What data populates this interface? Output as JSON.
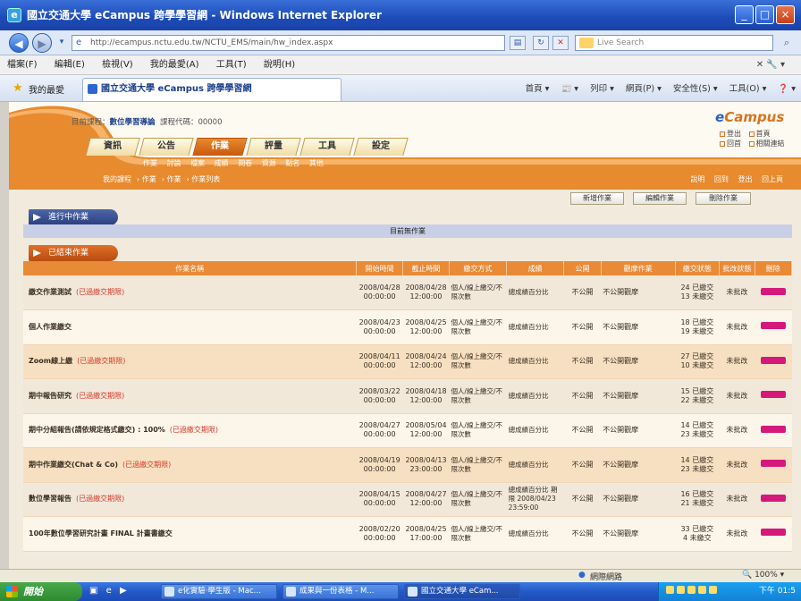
{
  "window": {
    "title": "國立交通大學 eCampus 跨學學習網 - Windows Internet Explorer",
    "min": "_",
    "max": "□",
    "close": "×"
  },
  "address": {
    "url": "http://ecampus.nctu.edu.tw/NCTU_EMS/main/hw_index.aspx",
    "search_placeholder": "Live Search"
  },
  "menu": {
    "items": [
      "檔案(F)",
      "編輯(E)",
      "檢視(V)",
      "我的最愛(A)",
      "工具(T)",
      "說明(H)"
    ],
    "right": "✕ 🔧 ▾"
  },
  "tabs": {
    "favorites": "我的最愛",
    "active_tab": "國立交通大學 eCampus 跨學學習網",
    "commands": [
      "首頁 ▾",
      "📰 ▾",
      "列印 ▾",
      "網頁(P) ▾",
      "安全性(S) ▾",
      "工具(O) ▾",
      "❓ ▾"
    ]
  },
  "page": {
    "user_label": "目前課程：",
    "course": "數位學習導論",
    "role_label": "課程代碼：",
    "code": "00000",
    "logo_prefix": "e",
    "logo": "Campus",
    "header_links": [
      "登出",
      "首頁",
      "回首",
      "相關連結"
    ],
    "nav": [
      "資訊",
      "公告",
      "作業",
      "評量",
      "工具",
      "設定"
    ],
    "submenu": [
      "作業",
      "討論",
      "檔案",
      "成績",
      "問卷",
      "資源",
      "點名",
      "其他"
    ],
    "breadcrumb": [
      "我的課程",
      "作業",
      "作業",
      "作業列表"
    ],
    "right_links": [
      "說明",
      "回到",
      "登出",
      "回上頁"
    ],
    "action_buttons": [
      "新增作業",
      "編輯作業",
      "刪除作業"
    ],
    "section_current": "進行中作業",
    "section_current_empty": "目前無作業",
    "section_past": "已結束作業",
    "columns": [
      "作業名稱",
      "開始時間",
      "截止時間",
      "繳交方式",
      "成績",
      "公開",
      "觀摩作業",
      "繳交狀態",
      "批改狀態",
      "刪除"
    ],
    "rows": [
      {
        "name": "繳交作業測試",
        "tag": "(已過繳交期限)",
        "start": "2008/04/28 00:00:00",
        "end": "2008/04/28 12:00:00",
        "method": "個人/線上繳交/不限次數",
        "grade": "總成績百分比",
        "public": "不公開",
        "peer": "不公開觀摩",
        "submitted": "24 已繳交",
        "pending": "13 未繳交",
        "status": "未批改"
      },
      {
        "name": "個人作業繳交",
        "tag": "",
        "start": "2008/04/23 00:00:00",
        "end": "2008/04/25 12:00:00",
        "method": "個人/線上繳交/不限次數",
        "grade": "總成績百分比",
        "public": "不公開",
        "peer": "不公開觀摩",
        "submitted": "18 已繳交",
        "pending": "19 未繳交",
        "status": "未批改"
      },
      {
        "name": "Zoom線上繳",
        "tag": "(已過繳交期限)",
        "start": "2008/04/11 00:00:00",
        "end": "2008/04/24 12:00:00",
        "method": "個人/線上繳交/不限次數",
        "grade": "總成績百分比",
        "public": "不公開",
        "peer": "不公開觀摩",
        "submitted": "27 已繳交",
        "pending": "10 未繳交",
        "status": "未批改"
      },
      {
        "name": "期中報告研究",
        "tag": "(已過繳交期限)",
        "start": "2008/03/22 00:00:00",
        "end": "2008/04/18 12:00:00",
        "method": "個人/線上繳交/不限次數",
        "grade": "總成績百分比",
        "public": "不公開",
        "peer": "不公開觀摩",
        "submitted": "15 已繳交",
        "pending": "22 未繳交",
        "status": "未批改"
      },
      {
        "name": "期中分組報告(請依規定格式繳交) : 100%",
        "tag": "(已過繳交期限)",
        "start": "2008/04/27 00:00:00",
        "end": "2008/05/04 12:00:00",
        "method": "個人/線上繳交/不限次數",
        "grade": "總成績百分比",
        "public": "不公開",
        "peer": "不公開觀摩",
        "submitted": "14 已繳交",
        "pending": "23 未繳交",
        "status": "未批改"
      },
      {
        "name": "期中作業繳交(Chat & Co)",
        "tag": "(已過繳交期限)",
        "start": "2008/04/19 00:00:00",
        "end": "2008/04/13 23:00:00",
        "method": "個人/線上繳交/不限次數",
        "grade": "總成績百分比",
        "public": "不公開",
        "peer": "不公開觀摩",
        "submitted": "14 已繳交",
        "pending": "23 未繳交",
        "status": "未批改"
      },
      {
        "name": "數位學習報告",
        "tag": "(已過繳交期限)",
        "start": "2008/04/15 00:00:00",
        "end": "2008/04/27 12:00:00",
        "method": "個人/線上繳交/不限次數",
        "grade": "總成績百分比 期限 2008/04/23 23:59:00",
        "public": "不公開",
        "peer": "不公開觀摩",
        "submitted": "16 已繳交",
        "pending": "21 未繳交",
        "status": "未批改"
      },
      {
        "name": "100年數位學習研究計畫 FINAL 計畫書繳交",
        "tag": "",
        "start": "2008/02/20 00:00:00",
        "end": "2008/04/25 17:00:00",
        "method": "個人/線上繳交/不限次數",
        "grade": "總成績百分比",
        "public": "不公開",
        "peer": "不公開觀摩",
        "submitted": "33 已繳交",
        "pending": "4 未繳交",
        "status": "未批改"
      }
    ]
  },
  "status": {
    "zone": "網際網路",
    "zoom": "🔍 100% ▾"
  },
  "taskbar": {
    "start": "開始",
    "tasks": [
      "e化實驗·學生版 - Mac...",
      "成果與一份表格 - M...",
      "國立交通大學 eCam..."
    ],
    "clock": "下午 01:5"
  },
  "colors": {
    "accent": "#e77c1a",
    "header_blue": "#2c3f7c",
    "delete_pill": "#d4197a"
  }
}
